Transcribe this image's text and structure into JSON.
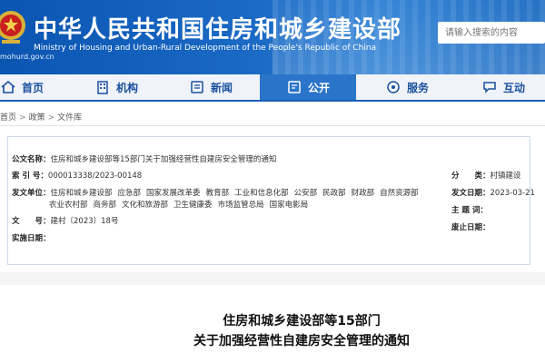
{
  "header": {
    "title": "中华人民共和国住房和城乡建设部",
    "subtitle": "Ministry of Housing and Urban-Rural Development of the People's Republic of China",
    "url": "mohurd.gov.cn",
    "search_placeholder": "请输入搜索的内容"
  },
  "nav": {
    "items": [
      {
        "label": "首页",
        "icon": "home-icon"
      },
      {
        "label": "机构",
        "icon": "building-icon"
      },
      {
        "label": "新闻",
        "icon": "news-icon"
      },
      {
        "label": "公开",
        "icon": "open-gov-icon",
        "active": true
      },
      {
        "label": "服务",
        "icon": "service-icon"
      },
      {
        "label": "互动",
        "icon": "interaction-icon"
      }
    ]
  },
  "breadcrumb": [
    "首页",
    "政策",
    "文件库"
  ],
  "meta": {
    "doc_name_label": "公文名称：",
    "doc_name": "住房和城乡建设部等15部门关于加强经营性自建房安全管理的通知",
    "index_label": "索 引 号：",
    "index_value": "000013338/2023-00148",
    "category_label": "分　　类：",
    "category_value": "村镇建设",
    "issuer_label": "发文单位：",
    "issuers_line1": [
      "住房和城乡建设部",
      "应急部",
      "国家发展改革委",
      "教育部",
      "工业和信息化部",
      "公安部",
      "民政部",
      "财政部",
      "自然资源部"
    ],
    "issuers_line2": [
      "农业农村部",
      "商务部",
      "文化和旅游部",
      "卫生健康委",
      "市场监管总局",
      "国家电影局"
    ],
    "date_label": "发文日期：",
    "date_value": "2023-03-21",
    "subject_label": "主 题 词：",
    "subject_value": "",
    "docno_label": "文　　号：",
    "docno_value": "建村〔2023〕18号",
    "abolish_label": "废止日期：",
    "abolish_value": "",
    "effective_label": "实施日期：",
    "effective_value": ""
  },
  "article": {
    "title_line1": "住房和城乡建设部等15部门",
    "title_line2": "关于加强经营性自建房安全管理的通知"
  },
  "colors": {
    "banner_blue": "#1a69c4",
    "nav_active": "#2a74c9",
    "nav_text": "#1a4f9c"
  }
}
